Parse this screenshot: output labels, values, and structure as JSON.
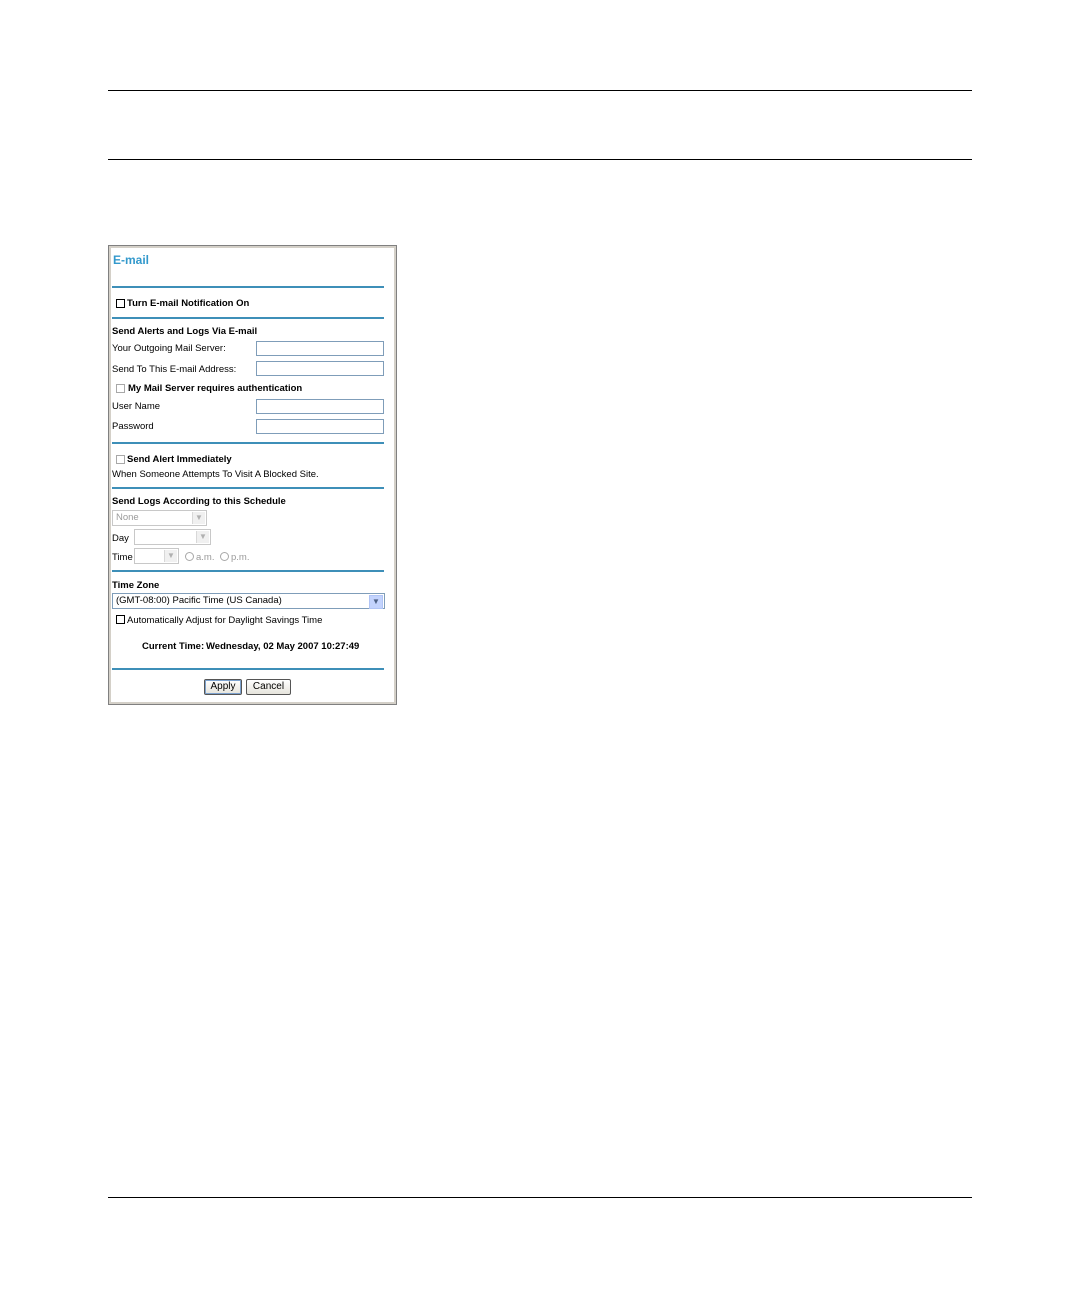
{
  "panel": {
    "title": "E-mail",
    "notification_label": "Turn E-mail Notification On",
    "send_alerts_heading": "Send Alerts and Logs Via E-mail",
    "outgoing_server_label": "Your Outgoing Mail Server:",
    "outgoing_server_value": "",
    "send_to_label": "Send To This E-mail Address:",
    "send_to_value": "",
    "auth_label": "My Mail Server requires authentication",
    "user_name_label": "User Name",
    "user_name_value": "",
    "password_label": "Password",
    "password_value": "",
    "alert_immediately_label": "Send Alert Immediately",
    "alert_description": "When Someone Attempts To Visit A Blocked Site.",
    "schedule_heading": "Send Logs According to this Schedule",
    "schedule_value": "None",
    "day_label": "Day",
    "day_value": "",
    "time_label": "Time",
    "time_value": "",
    "am_label": "a.m.",
    "pm_label": "p.m.",
    "time_zone_heading": "Time Zone",
    "time_zone_value": "(GMT-08:00) Pacific Time (US Canada)",
    "dst_label": "Automatically Adjust for Daylight Savings Time",
    "current_time_label": "Current Time:",
    "current_time_value": "Wednesday, 02 May 2007 10:27:49",
    "apply_label": "Apply",
    "cancel_label": "Cancel"
  },
  "icons": {
    "dropdown": "chevron-down-icon"
  },
  "colors": {
    "title": "#3399cc",
    "divider": "#3e8fb8"
  }
}
